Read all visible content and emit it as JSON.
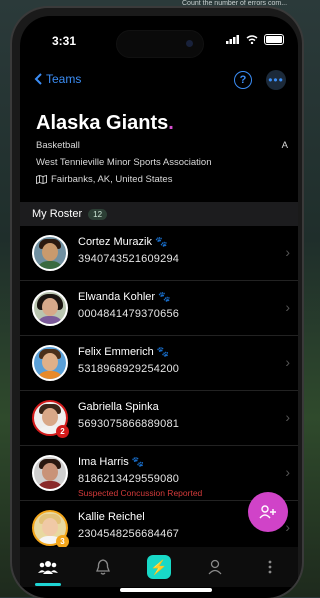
{
  "background_text": "Count the number of errors com... ...mmitte...",
  "status_bar": {
    "time": "3:31"
  },
  "nav": {
    "back_label": "Teams",
    "help_icon": "question-circle-icon",
    "more_icon": "ellipsis-icon"
  },
  "team": {
    "name": "Alaska Giants",
    "sport": "Basketball",
    "sport_right": "A",
    "association": "West Tennieville Minor Sports Association",
    "location": "Fairbanks, AK, United States"
  },
  "roster": {
    "title": "My Roster",
    "count": "12",
    "players": [
      {
        "name": "Cortez Murazik",
        "id": "3940743521609294",
        "paw": true,
        "border": "white",
        "badge": "",
        "warning": ""
      },
      {
        "name": "Elwanda Kohler",
        "id": "0004841479370656",
        "paw": true,
        "border": "white",
        "badge": "",
        "warning": ""
      },
      {
        "name": "Felix Emmerich",
        "id": "5318968929254200",
        "paw": true,
        "border": "white",
        "badge": "",
        "warning": ""
      },
      {
        "name": "Gabriella Spinka",
        "id": "5693075866889081",
        "paw": false,
        "border": "red",
        "badge": "2",
        "warning": ""
      },
      {
        "name": "Ima Harris",
        "id": "8186213429559080",
        "paw": true,
        "border": "white",
        "badge": "",
        "warning": "Suspected Concussion Reported"
      },
      {
        "name": "Kallie Reichel",
        "id": "2304548256684467",
        "paw": false,
        "border": "gold",
        "badge": "3",
        "warning": ""
      }
    ]
  },
  "fab": {
    "icon": "add-person-icon"
  },
  "tabbar": {
    "items": [
      {
        "name": "team-tab",
        "icon": "people-icon",
        "active": true
      },
      {
        "name": "notifications-tab",
        "icon": "bell-icon",
        "active": false
      },
      {
        "name": "action-tab",
        "icon": "lightning-icon",
        "active": false
      },
      {
        "name": "profile-tab",
        "icon": "person-icon",
        "active": false
      },
      {
        "name": "more-tab",
        "icon": "vertical-ellipsis-icon",
        "active": false
      }
    ]
  },
  "colors": {
    "accent_blue": "#3b8df5",
    "magenta": "#d043c8",
    "teal": "#18d9c7",
    "warning_red": "#d33a3a"
  }
}
